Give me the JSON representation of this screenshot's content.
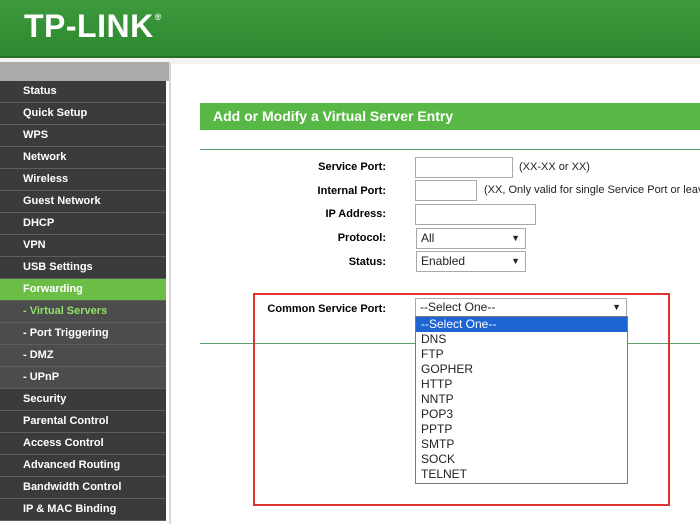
{
  "brand": {
    "name": "TP-LINK",
    "mark": "®"
  },
  "sidebar": {
    "items": [
      {
        "label": "Status"
      },
      {
        "label": "Quick Setup"
      },
      {
        "label": "WPS"
      },
      {
        "label": "Network"
      },
      {
        "label": "Wireless"
      },
      {
        "label": "Guest Network"
      },
      {
        "label": "DHCP"
      },
      {
        "label": "VPN"
      },
      {
        "label": "USB Settings"
      },
      {
        "label": "Forwarding"
      },
      {
        "label": "- Virtual Servers"
      },
      {
        "label": "- Port Triggering"
      },
      {
        "label": "- DMZ"
      },
      {
        "label": "- UPnP"
      },
      {
        "label": "Security"
      },
      {
        "label": "Parental Control"
      },
      {
        "label": "Access Control"
      },
      {
        "label": "Advanced Routing"
      },
      {
        "label": "Bandwidth Control"
      },
      {
        "label": "IP & MAC Binding"
      }
    ]
  },
  "form": {
    "title": "Add or Modify a Virtual Server Entry",
    "service_port": {
      "label": "Service Port:",
      "value": "",
      "hint": "(XX-XX or XX)"
    },
    "internal_port": {
      "label": "Internal Port:",
      "value": "",
      "hint": "(XX, Only valid for single Service Port or leav"
    },
    "ip_address": {
      "label": "IP Address:",
      "value": ""
    },
    "protocol": {
      "label": "Protocol:",
      "value": "All"
    },
    "status": {
      "label": "Status:",
      "value": "Enabled"
    },
    "common_port": {
      "label": "Common Service Port:",
      "value": "--Select One--",
      "options": [
        "--Select One--",
        "DNS",
        "FTP",
        "GOPHER",
        "HTTP",
        "NNTP",
        "POP3",
        "PPTP",
        "SMTP",
        "SOCK",
        "TELNET"
      ]
    }
  },
  "colors": {
    "brand_green": "#3d9a3d",
    "accent_green": "#58b846",
    "highlight_red": "#e0332f",
    "option_highlight": "#1e64d2"
  }
}
